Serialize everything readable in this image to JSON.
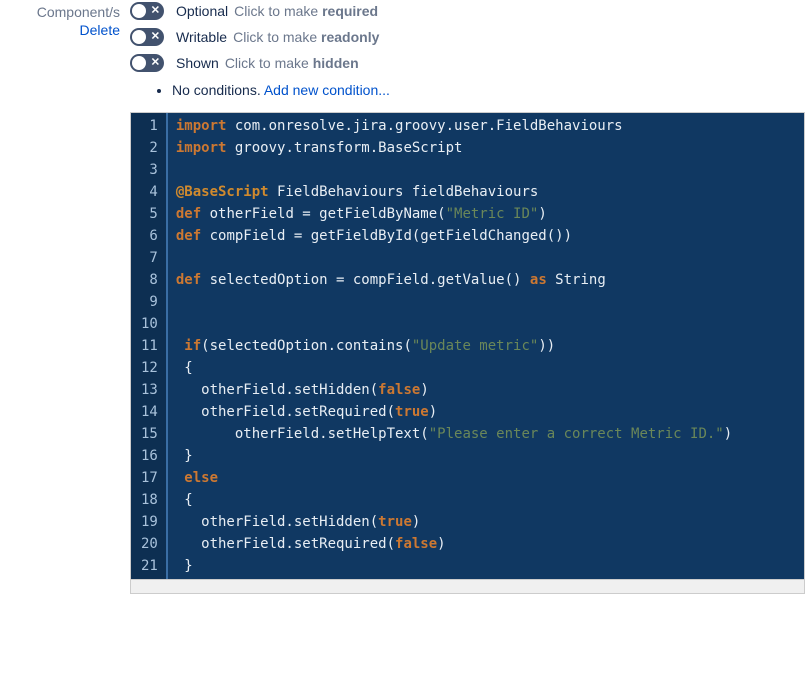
{
  "field": {
    "label": "Component/s",
    "delete": "Delete"
  },
  "toggles": [
    {
      "state": "Optional",
      "hint_pre": "Click to make ",
      "hint_bold": "required"
    },
    {
      "state": "Writable",
      "hint_pre": "Click to make ",
      "hint_bold": "readonly"
    },
    {
      "state": "Shown",
      "hint_pre": "Click to make ",
      "hint_bold": "hidden"
    }
  ],
  "conditions": {
    "text": "No conditions. ",
    "add": "Add new condition..."
  },
  "code": {
    "line_count": 21,
    "tokens": [
      [
        {
          "t": "import",
          "c": "kw"
        },
        {
          "t": " com.onresolve.jira.groovy.user.FieldBehaviours",
          "c": "txt"
        }
      ],
      [
        {
          "t": "import",
          "c": "kw"
        },
        {
          "t": " groovy.transform.BaseScript",
          "c": "txt"
        }
      ],
      [],
      [
        {
          "t": "@BaseScript",
          "c": "ann"
        },
        {
          "t": " FieldBehaviours fieldBehaviours",
          "c": "txt"
        }
      ],
      [
        {
          "t": "def",
          "c": "kw"
        },
        {
          "t": " otherField = getFieldByName(",
          "c": "txt"
        },
        {
          "t": "\"Metric ID\"",
          "c": "str"
        },
        {
          "t": ")",
          "c": "txt"
        }
      ],
      [
        {
          "t": "def",
          "c": "kw"
        },
        {
          "t": " compField = getFieldById(getFieldChanged())",
          "c": "txt"
        }
      ],
      [],
      [
        {
          "t": "def",
          "c": "kw"
        },
        {
          "t": " selectedOption = compField.getValue() ",
          "c": "txt"
        },
        {
          "t": "as",
          "c": "kw"
        },
        {
          "t": " String",
          "c": "txt"
        }
      ],
      [],
      [],
      [
        {
          "t": " ",
          "c": "txt"
        },
        {
          "t": "if",
          "c": "kw"
        },
        {
          "t": "(selectedOption.contains(",
          "c": "txt"
        },
        {
          "t": "\"Update metric\"",
          "c": "str"
        },
        {
          "t": "))",
          "c": "txt"
        }
      ],
      [
        {
          "t": " {",
          "c": "txt"
        }
      ],
      [
        {
          "t": "   otherField.setHidden(",
          "c": "txt"
        },
        {
          "t": "false",
          "c": "lit"
        },
        {
          "t": ")",
          "c": "txt"
        }
      ],
      [
        {
          "t": "   otherField.setRequired(",
          "c": "txt"
        },
        {
          "t": "true",
          "c": "lit"
        },
        {
          "t": ")",
          "c": "txt"
        }
      ],
      [
        {
          "t": "       otherField.setHelpText(",
          "c": "txt"
        },
        {
          "t": "\"Please enter a correct Metric ID.\"",
          "c": "str"
        },
        {
          "t": ")",
          "c": "txt"
        }
      ],
      [
        {
          "t": " }",
          "c": "txt"
        }
      ],
      [
        {
          "t": " ",
          "c": "txt"
        },
        {
          "t": "else",
          "c": "kw"
        }
      ],
      [
        {
          "t": " {",
          "c": "txt"
        }
      ],
      [
        {
          "t": "   otherField.setHidden(",
          "c": "txt"
        },
        {
          "t": "true",
          "c": "lit"
        },
        {
          "t": ")",
          "c": "txt"
        }
      ],
      [
        {
          "t": "   otherField.setRequired(",
          "c": "txt"
        },
        {
          "t": "false",
          "c": "lit"
        },
        {
          "t": ")",
          "c": "txt"
        }
      ],
      [
        {
          "t": " }",
          "c": "txt"
        }
      ]
    ]
  }
}
